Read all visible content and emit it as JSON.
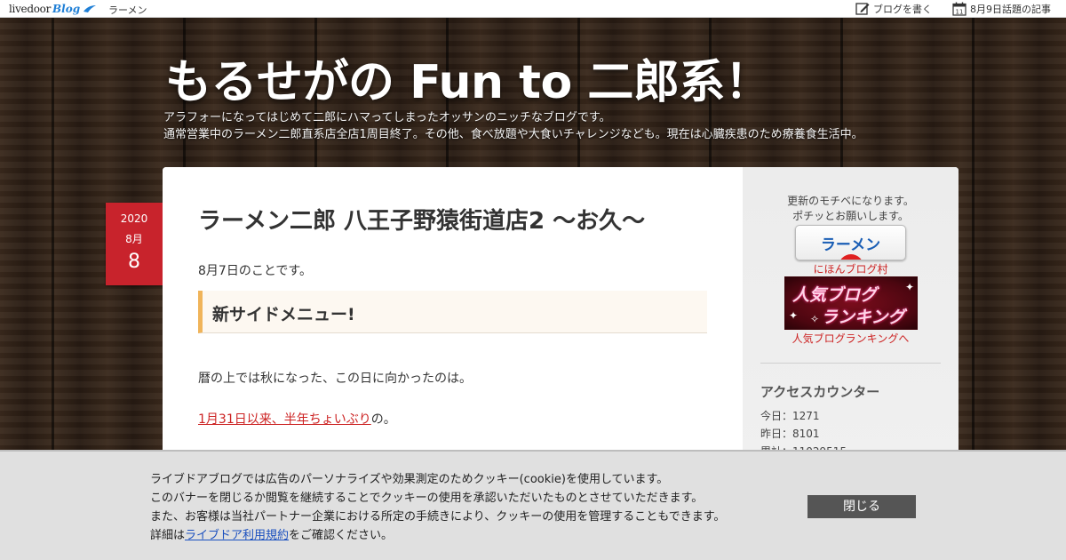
{
  "topbar": {
    "logo_text": "livedoor",
    "logo_blog": "Blog",
    "category": "ラーメン",
    "write_label": "ブログを書く",
    "calendar_day": "11",
    "topic_label": "8月9日話題の記事"
  },
  "header": {
    "title": "もるせがの Fun to 二郎系！",
    "desc_line1": "アラフォーになってはじめて二郎にハマってしまったオッサンのニッチなブログです。",
    "desc_line2": "通常営業中のラーメン二郎直系店全店1周目終了。その他、食べ放題や大食いチャレンジなども。現在は心臓疾患のため療養食生活中。"
  },
  "date": {
    "year": "2020",
    "month": "8月",
    "day": "8"
  },
  "article": {
    "title": "ラーメン二郎 八王子野猿街道店2 〜お久〜",
    "intro": "8月7日のことです。",
    "section_heading": "新サイドメニュー!",
    "para1": "暦の上では秋になった、この日に向かったのは。",
    "para2_link": "1月31日以来、半年ちょいぶり",
    "para2_tail": "の。"
  },
  "sidebar": {
    "note_line1": "更新のモチベになります。",
    "note_line2": "ポチッとお願いします。",
    "ramen_banner": "ラーメン",
    "nihon_link": "にほんブログ村",
    "rank_line1": "人気ブログ",
    "rank_line2": "ランキング",
    "rank_link": "人気ブログランキングへ",
    "counter_heading": "アクセスカウンター",
    "today": "今日：1271",
    "yesterday": "昨日：8101",
    "total": "累計：11029515"
  },
  "cookie": {
    "line1": "ライブドアブログでは広告のパーソナライズや効果測定のためクッキー(cookie)を使用しています。",
    "line2": "このバナーを閉じるか閲覧を継続することでクッキーの使用を承認いただいたものとさせていただきます。",
    "line3": "また、お客様は当社パートナー企業における所定の手続きにより、クッキーの使用を管理することもできます。",
    "line4_prefix": "詳細は",
    "line4_link": "ライブドア利用規約",
    "line4_suffix": "をご確認ください。",
    "close_label": "閉じる"
  },
  "colors": {
    "date_red": "#c8232c",
    "link_red": "#cc2222",
    "heading_accent": "#f0b45a",
    "close_button": "#555555"
  }
}
